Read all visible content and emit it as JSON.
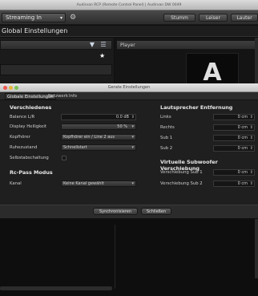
{
  "main_window": {
    "title": "Audirvan RCP (Remote Control Panel) | Audirvan DW 0049",
    "source_dropdown": "Streaming In",
    "toolbar_buttons": [
      "Stumm",
      "Leiser",
      "Lauter"
    ],
    "subtitle": "Global Einstellungen",
    "right_panel_header": "Player",
    "art_letter": "A"
  },
  "dialog": {
    "title": "Gerate Einstellungen",
    "tabs": [
      "Globale Einstellungen",
      "Netzwerk",
      "Info"
    ],
    "verschiedenes": {
      "title": "Verschiedenes",
      "balance_label": "Balance L/R",
      "balance_value": "0.0 dB",
      "display_label": "Display Helligkeit",
      "display_value": "50 %",
      "kopfhoerer_label": "Kopfhörer",
      "kopfhoerer_value": "Kopfhörer ein / Line 2 aus",
      "ruhezustand_label": "Ruhezustand",
      "ruhezustand_value": "Schnellstart",
      "selbstabschaltung_label": "Selbstabschaltung"
    },
    "rc_pass": {
      "title": "Rc-Pass Modus",
      "kanal_label": "Kanal",
      "kanal_value": "Keine Kanal gewählt"
    },
    "lautsprecher": {
      "title": "Lautsprecher Entfernung",
      "rows": [
        {
          "label": "Links",
          "value": "0 cm"
        },
        {
          "label": "Rechts",
          "value": "0 cm"
        },
        {
          "label": "Sub 1",
          "value": "0 cm"
        },
        {
          "label": "Sub 2",
          "value": "0 cm"
        }
      ]
    },
    "subwoofer": {
      "title": "Virtuelle Subwoofer Verschiebung",
      "rows": [
        {
          "label": "Verschiebung Sub 1",
          "value": "0 cm"
        },
        {
          "label": "Verschiebung Sub 2",
          "value": "0 cm"
        }
      ]
    },
    "buttons": {
      "sync": "Synchronisieren",
      "close": "Schließen"
    }
  },
  "colors": {
    "traffic_red": "#ee5a52",
    "traffic_yellow": "#e7b53b",
    "traffic_green": "#7cc24f"
  }
}
